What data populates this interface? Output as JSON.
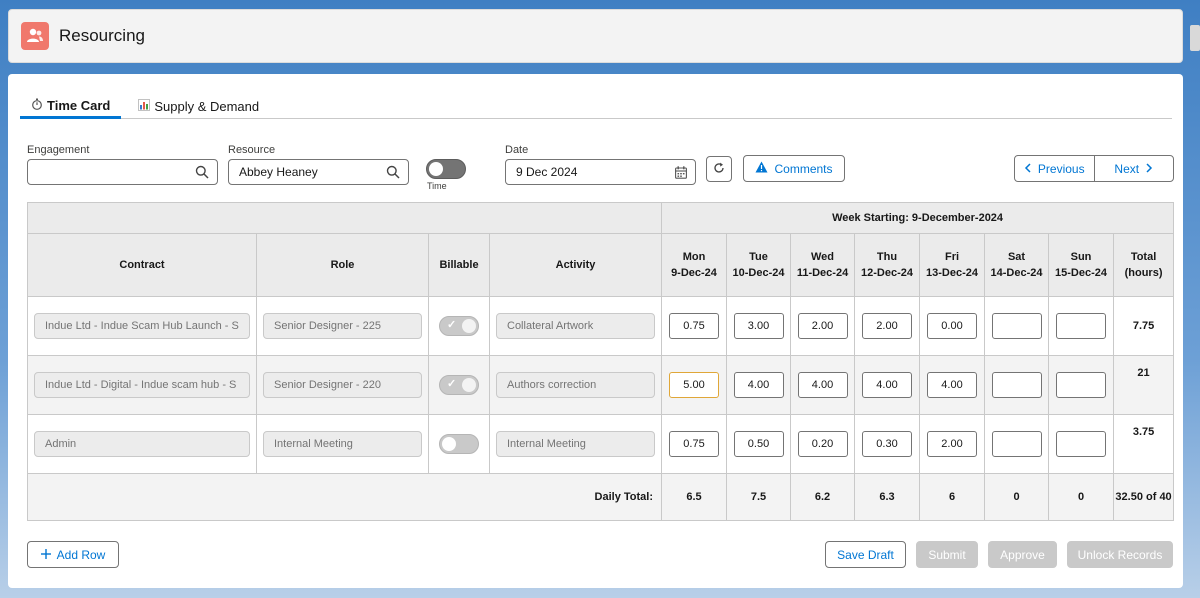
{
  "app": {
    "title": "Resourcing"
  },
  "tabs": [
    {
      "label": "Time Card",
      "icon": "stopwatch-icon",
      "active": true
    },
    {
      "label": "Supply & Demand",
      "icon": "bar-chart-icon",
      "active": false
    }
  ],
  "filters": {
    "engagement_label": "Engagement",
    "engagement_value": "",
    "resource_label": "Resource",
    "resource_value": "Abbey Heaney",
    "time_toggle_label": "Time",
    "date_label": "Date",
    "date_value": "9 Dec 2024",
    "comments_label": "Comments",
    "previous_label": "Previous",
    "next_label": "Next"
  },
  "grid": {
    "week_heading": "Week Starting: 9-December-2024",
    "columns": {
      "contract": "Contract",
      "role": "Role",
      "billable": "Billable",
      "activity": "Activity",
      "total": "Total (hours)"
    },
    "days": [
      {
        "name": "Mon",
        "date": "9-Dec-24"
      },
      {
        "name": "Tue",
        "date": "10-Dec-24"
      },
      {
        "name": "Wed",
        "date": "11-Dec-24"
      },
      {
        "name": "Thu",
        "date": "12-Dec-24"
      },
      {
        "name": "Fri",
        "date": "13-Dec-24"
      },
      {
        "name": "Sat",
        "date": "14-Dec-24"
      },
      {
        "name": "Sun",
        "date": "15-Dec-24"
      }
    ],
    "rows": [
      {
        "contract": "Indue Ltd - Indue Scam Hub Launch - S",
        "role": "Senior Designer - 225",
        "billable": true,
        "activity": "Collateral Artwork",
        "hours": [
          "0.75",
          "3.00",
          "2.00",
          "2.00",
          "0.00",
          "",
          ""
        ],
        "total": "7.75"
      },
      {
        "contract": "Indue Ltd - Digital - Indue scam hub - S",
        "role": "Senior Designer - 220",
        "billable": true,
        "activity": "Authors correction",
        "hours": [
          "5.00",
          "4.00",
          "4.00",
          "4.00",
          "4.00",
          "",
          ""
        ],
        "total": "21"
      },
      {
        "contract": "Admin",
        "role": "Internal Meeting",
        "billable": false,
        "activity": "Internal Meeting",
        "hours": [
          "0.75",
          "0.50",
          "0.20",
          "0.30",
          "2.00",
          "",
          ""
        ],
        "total": "3.75"
      }
    ],
    "daily_total_label": "Daily Total:",
    "daily_totals": [
      "6.5",
      "7.5",
      "6.2",
      "6.3",
      "6",
      "0",
      "0"
    ],
    "grand_total": "32.50 of 40"
  },
  "actions": {
    "add_row": "Add Row",
    "save_draft": "Save Draft",
    "submit": "Submit",
    "approve": "Approve",
    "unlock_records": "Unlock Records"
  },
  "colors": {
    "accent": "#0176d3",
    "app_icon": "#f0786c",
    "disabled": "#c9c9c9",
    "focus_border": "#e0a738"
  }
}
